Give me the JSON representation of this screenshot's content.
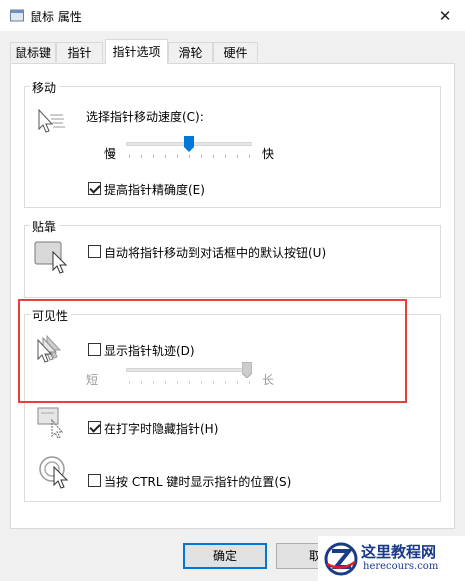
{
  "window": {
    "title": "鼠标 属性",
    "close_glyph": "✕"
  },
  "tabs": [
    {
      "label": "鼠标键",
      "active": false
    },
    {
      "label": "指针",
      "active": false
    },
    {
      "label": "指针选项",
      "active": true
    },
    {
      "label": "滑轮",
      "active": false
    },
    {
      "label": "硬件",
      "active": false
    }
  ],
  "motion": {
    "legend": "移动",
    "speed_label": "选择指针移动速度(C):",
    "slow_label": "慢",
    "fast_label": "快",
    "speed_level": 0.5,
    "precision_label": "提高指针精确度(E)",
    "precision_checked": true
  },
  "snap": {
    "legend": "贴靠",
    "snap_label": "自动将指针移动到对话框中的默认按钮(U)",
    "snap_checked": false
  },
  "visibility": {
    "legend": "可见性",
    "trails_label": "显示指针轨迹(D)",
    "trails_checked": false,
    "short_label": "短",
    "long_label": "长",
    "trail_level": 1.0,
    "hide_typing_label": "在打字时隐藏指针(H)",
    "hide_typing_checked": true,
    "ctrl_label": "当按 CTRL 键时显示指针的位置(S)",
    "ctrl_checked": false
  },
  "buttons": {
    "ok": "确定",
    "cancel": "取"
  },
  "watermark": {
    "title": "这里教程网",
    "url": "herecours.com"
  },
  "colors": {
    "highlight": "#e4403c",
    "accent": "#0078d7",
    "thumb": "#0078d7"
  },
  "icons": {
    "motion": "pointer-speed-icon",
    "snap": "snap-to-button-icon",
    "trails": "pointer-trails-icon",
    "hide": "hide-pointer-icon",
    "ctrl": "locate-pointer-icon"
  }
}
